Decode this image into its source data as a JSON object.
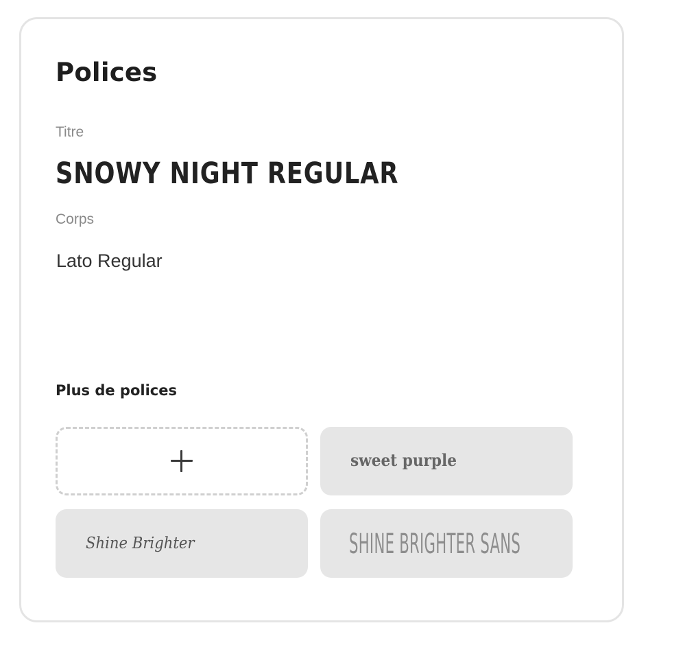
{
  "panel": {
    "title": "Polices"
  },
  "heading": {
    "label": "Titre",
    "font_name": "SNOWY NIGHT REGULAR"
  },
  "body": {
    "label": "Corps",
    "font_name": "Lato Regular"
  },
  "more_fonts": {
    "label": "Plus de polices",
    "add_icon": "plus-icon",
    "options": [
      {
        "name": "sweet purple"
      },
      {
        "name": "Shine Brighter"
      },
      {
        "name": "SHINE BRIGHTER SANS"
      }
    ]
  },
  "colors": {
    "panel_border": "#e4e4e4",
    "tile_background": "#e6e6e6",
    "dashed_border": "#cfcfcf"
  }
}
